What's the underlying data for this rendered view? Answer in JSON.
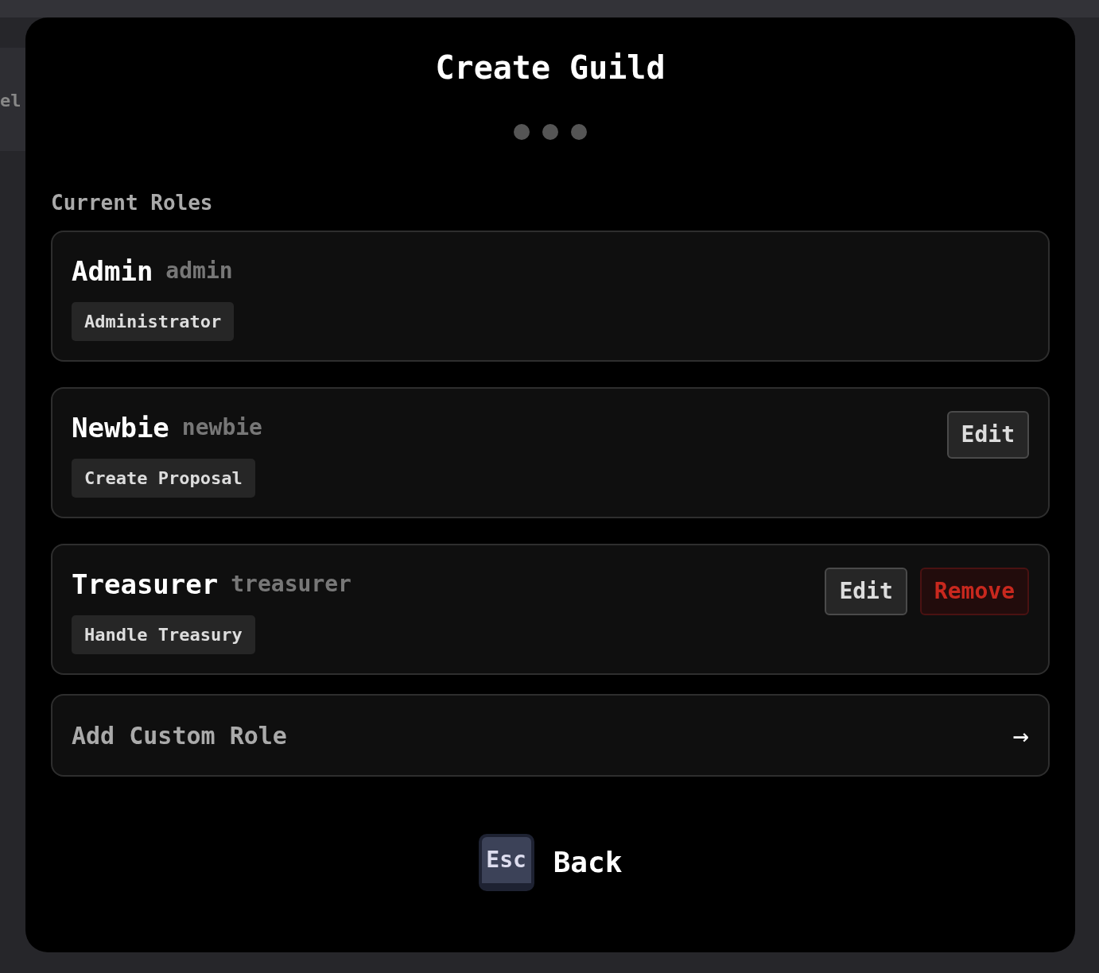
{
  "background": {
    "label": "el"
  },
  "dialog": {
    "title": "Create Guild",
    "steps": [
      {
        "selected": false
      },
      {
        "selected": false
      },
      {
        "selected": false
      }
    ],
    "section_title": "Current Roles",
    "roles": [
      {
        "name": "Admin",
        "slug": "admin",
        "permissions": [
          "Administrator"
        ]
      },
      {
        "name": "Newbie",
        "slug": "newbie",
        "permissions": [
          "Create Proposal"
        ],
        "actions": [
          {
            "kind": "edit",
            "label": "Edit"
          }
        ]
      },
      {
        "name": "Treasurer",
        "slug": "treasurer",
        "permissions": [
          "Handle Treasury"
        ],
        "actions": [
          {
            "kind": "edit",
            "label": "Edit"
          },
          {
            "kind": "remove",
            "label": "Remove"
          }
        ]
      }
    ],
    "add_role": {
      "label": "Add Custom Role",
      "arrow": "→"
    },
    "footer": {
      "key": "Esc",
      "label": "Back"
    }
  }
}
